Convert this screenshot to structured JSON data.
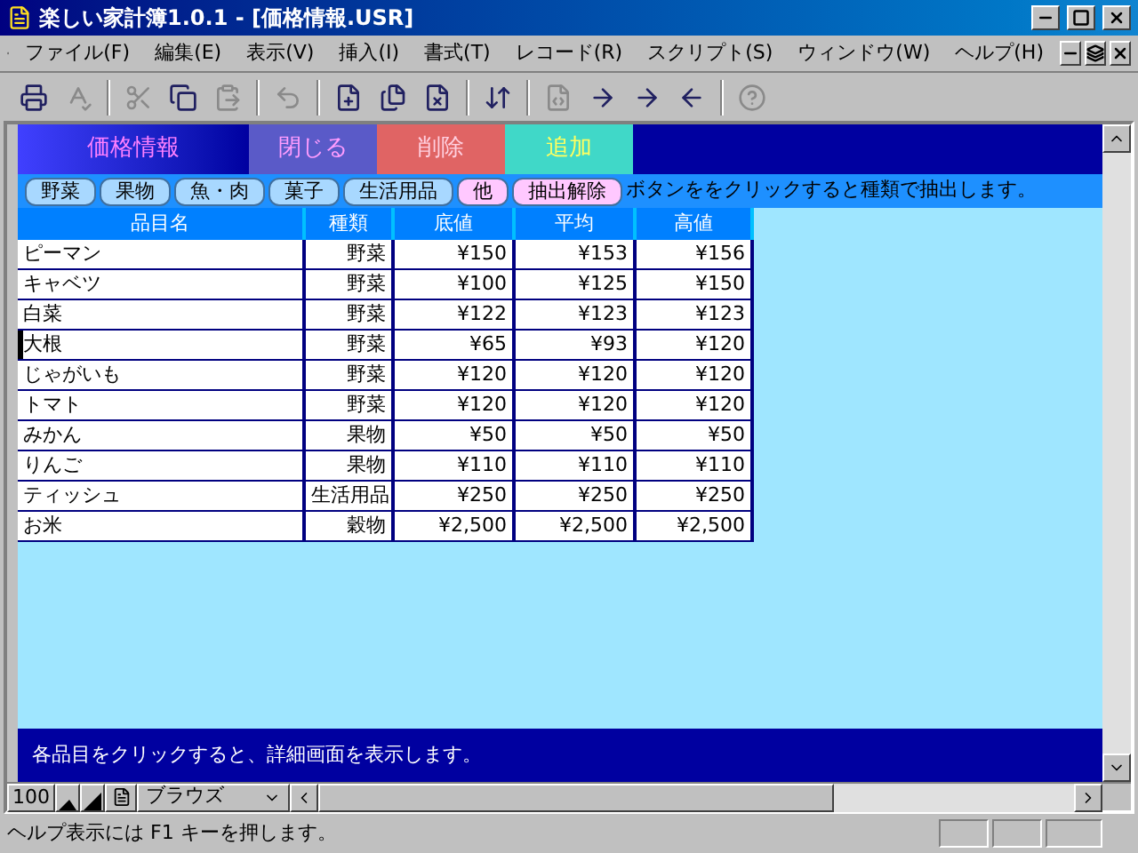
{
  "window": {
    "title": "楽しい家計簿1.0.1 - [価格情報.USR]"
  },
  "menu": [
    "ファイル(F)",
    "編集(E)",
    "表示(V)",
    "挿入(I)",
    "書式(T)",
    "レコード(R)",
    "スクリプト(S)",
    "ウィンドウ(W)",
    "ヘルプ(H)"
  ],
  "toolbar": [
    {
      "kind": "print",
      "disabled": false
    },
    {
      "kind": "spell",
      "disabled": true
    },
    {
      "kind": "sep"
    },
    {
      "kind": "cut",
      "disabled": true
    },
    {
      "kind": "copy",
      "disabled": false
    },
    {
      "kind": "paste",
      "disabled": true
    },
    {
      "kind": "sep"
    },
    {
      "kind": "undo",
      "disabled": true
    },
    {
      "kind": "sep"
    },
    {
      "kind": "new-record",
      "disabled": false
    },
    {
      "kind": "duplicate",
      "disabled": false
    },
    {
      "kind": "delete-record",
      "disabled": false
    },
    {
      "kind": "sep"
    },
    {
      "kind": "sort",
      "disabled": false
    },
    {
      "kind": "sep"
    },
    {
      "kind": "script",
      "disabled": true
    },
    {
      "kind": "next",
      "disabled": false
    },
    {
      "kind": "next",
      "disabled": false
    },
    {
      "kind": "prev",
      "disabled": false
    },
    {
      "kind": "sep"
    },
    {
      "kind": "help",
      "disabled": true
    }
  ],
  "header": {
    "title": "価格情報",
    "buttons": [
      {
        "label": "閉じる",
        "kind": "close"
      },
      {
        "label": "削除",
        "kind": "delete"
      },
      {
        "label": "追加",
        "kind": "add"
      }
    ]
  },
  "filters": [
    {
      "label": "野菜",
      "kind": "category"
    },
    {
      "label": "果物",
      "kind": "category"
    },
    {
      "label": "魚・肉",
      "kind": "category"
    },
    {
      "label": "菓子",
      "kind": "category"
    },
    {
      "label": "生活用品",
      "kind": "category"
    },
    {
      "label": "他",
      "kind": "other"
    },
    {
      "label": "抽出解除",
      "kind": "other"
    }
  ],
  "filter_hint": "ボタンををクリックすると種類で抽出します。",
  "table": {
    "columns": [
      "品目名",
      "種類",
      "底値",
      "平均",
      "高値"
    ],
    "rows": [
      {
        "name": "ピーマン",
        "type": "野菜",
        "low": "¥150",
        "avg": "¥153",
        "high": "¥156",
        "selected": false
      },
      {
        "name": "キャベツ",
        "type": "野菜",
        "low": "¥100",
        "avg": "¥125",
        "high": "¥150",
        "selected": false
      },
      {
        "name": "白菜",
        "type": "野菜",
        "low": "¥122",
        "avg": "¥123",
        "high": "¥123",
        "selected": false
      },
      {
        "name": "大根",
        "type": "野菜",
        "low": "¥65",
        "avg": "¥93",
        "high": "¥120",
        "selected": true
      },
      {
        "name": "じゃがいも",
        "type": "野菜",
        "low": "¥120",
        "avg": "¥120",
        "high": "¥120",
        "selected": false
      },
      {
        "name": "トマト",
        "type": "野菜",
        "low": "¥120",
        "avg": "¥120",
        "high": "¥120",
        "selected": false
      },
      {
        "name": "みかん",
        "type": "果物",
        "low": "¥50",
        "avg": "¥50",
        "high": "¥50",
        "selected": false
      },
      {
        "name": "りんご",
        "type": "果物",
        "low": "¥110",
        "avg": "¥110",
        "high": "¥110",
        "selected": false
      },
      {
        "name": "ティッシュ",
        "type": "生活用品",
        "low": "¥250",
        "avg": "¥250",
        "high": "¥250",
        "selected": false
      },
      {
        "name": "お米",
        "type": "穀物",
        "low": "¥2,500",
        "avg": "¥2,500",
        "high": "¥2,500",
        "selected": false
      }
    ]
  },
  "footer": "各品目をクリックすると、詳細画面を表示します。",
  "bottom_bar": {
    "zoom": "100",
    "mode": "ブラウズ"
  },
  "status_bar": "ヘルプ表示には F1 キーを押します。"
}
